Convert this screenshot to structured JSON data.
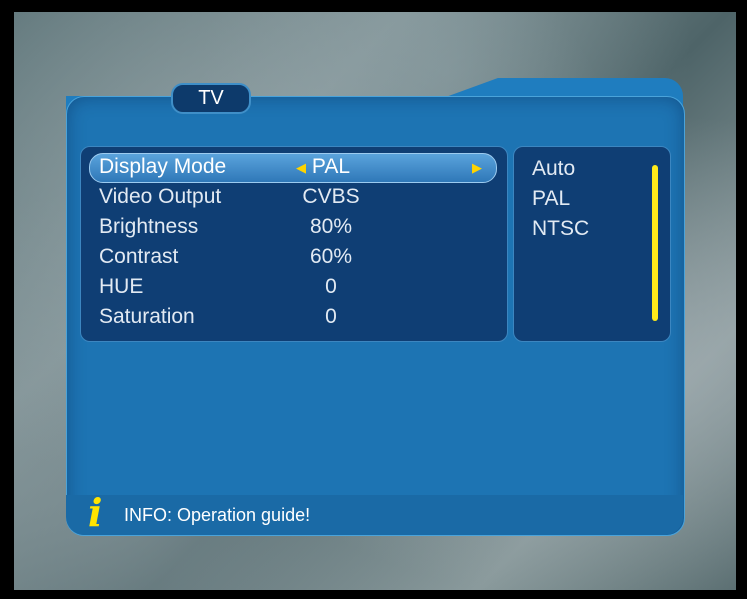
{
  "title": "TV",
  "menu": {
    "rows": [
      {
        "label": "Display Mode",
        "value": "PAL",
        "selected": true
      },
      {
        "label": "Video Output",
        "value": "CVBS"
      },
      {
        "label": "Brightness",
        "value": "80%"
      },
      {
        "label": "Contrast",
        "value": "60%"
      },
      {
        "label": "HUE",
        "value": "0"
      },
      {
        "label": "Saturation",
        "value": "0"
      }
    ]
  },
  "options": [
    "Auto",
    "PAL",
    "NTSC"
  ],
  "info": {
    "text": "INFO: Operation guide!"
  },
  "colors": {
    "accent": "#ffeb1a",
    "panel": "#1d74b3",
    "box": "#0f3e74"
  }
}
